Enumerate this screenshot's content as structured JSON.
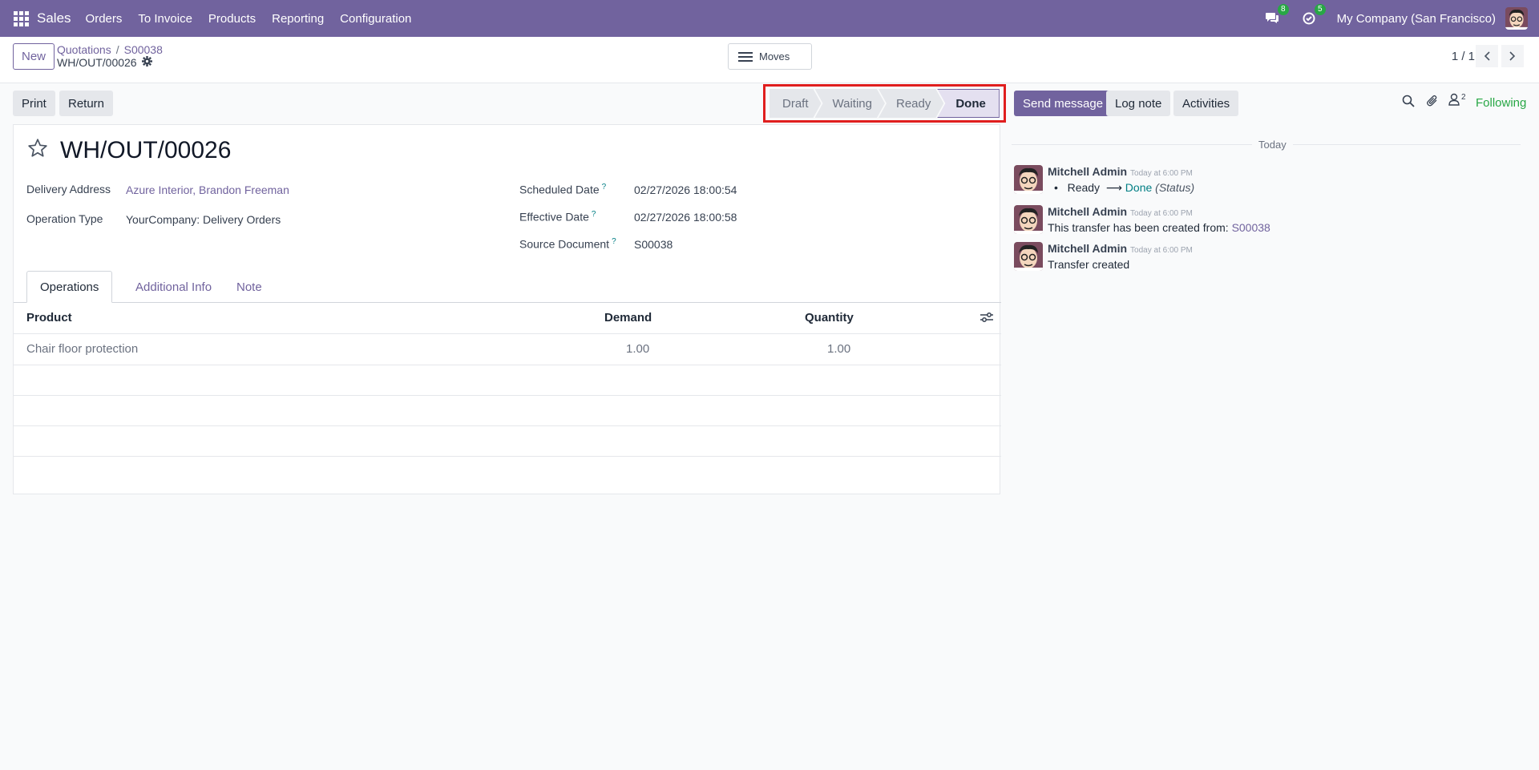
{
  "navbar": {
    "app_name": "Sales",
    "menu": [
      "Orders",
      "To Invoice",
      "Products",
      "Reporting",
      "Configuration"
    ],
    "messages_badge": "8",
    "activities_badge": "5",
    "company": "My Company (San Francisco)"
  },
  "control": {
    "new_label": "New",
    "breadcrumb": [
      "Quotations",
      "S00038"
    ],
    "record_name": "WH/OUT/00026",
    "moves_label": "Moves",
    "pager": "1 / 1"
  },
  "actions": {
    "print_label": "Print",
    "return_label": "Return"
  },
  "status": {
    "stages": [
      "Draft",
      "Waiting",
      "Ready",
      "Done"
    ],
    "current": "Done"
  },
  "form": {
    "title": "WH/OUT/00026",
    "delivery_address_label": "Delivery Address",
    "delivery_address_value": "Azure Interior, Brandon Freeman",
    "operation_type_label": "Operation Type",
    "operation_type_value": "YourCompany: Delivery Orders",
    "scheduled_date_label": "Scheduled Date",
    "scheduled_date_value": "02/27/2026 18:00:54",
    "effective_date_label": "Effective Date",
    "effective_date_value": "02/27/2026 18:00:58",
    "source_document_label": "Source Document",
    "source_document_value": "S00038",
    "help_mark": "?"
  },
  "tabs": [
    "Operations",
    "Additional Info",
    "Note"
  ],
  "table": {
    "headers": [
      "Product",
      "Demand",
      "Quantity"
    ],
    "rows": [
      {
        "product": "Chair floor protection",
        "demand": "1.00",
        "quantity": "1.00"
      }
    ]
  },
  "chatter": {
    "send_message_label": "Send message",
    "log_note_label": "Log note",
    "activities_label": "Activities",
    "followers_count": "2",
    "following_label": "Following",
    "today_label": "Today",
    "messages": [
      {
        "author": "Mitchell Admin",
        "time": "Today at 6:00 PM",
        "from_status": "Ready",
        "to_status": "Done",
        "field": "(Status)"
      },
      {
        "author": "Mitchell Admin",
        "time": "Today at 6:00 PM",
        "text": "This transfer has been created from:",
        "link": "S00038"
      },
      {
        "author": "Mitchell Admin",
        "time": "Today at 6:00 PM",
        "text": "Transfer created"
      }
    ]
  },
  "colors": {
    "brand": "#71639e",
    "success": "#28a745",
    "highlight": "#e01e1e"
  }
}
